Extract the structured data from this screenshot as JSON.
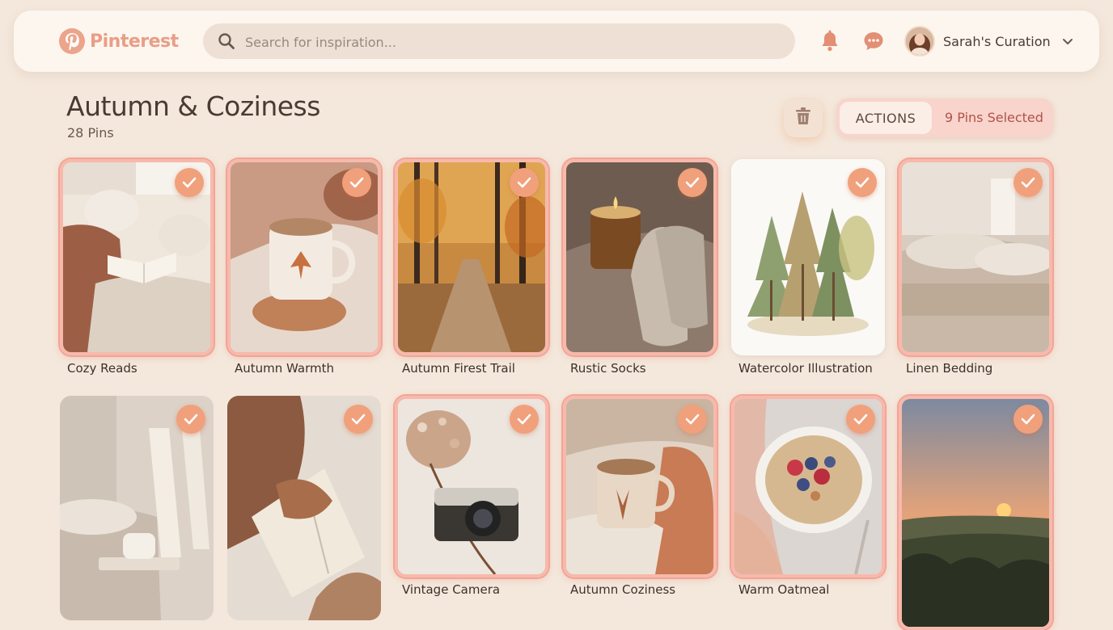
{
  "brand": {
    "name": "Pinterest",
    "color": "#e99e86"
  },
  "search": {
    "placeholder": "Search for inspiration..."
  },
  "header_icons": [
    "search-icon",
    "bell-icon",
    "chat-icon",
    "chevron-down-icon"
  ],
  "user": {
    "name": "Sarah's Curation"
  },
  "board": {
    "title": "Autumn & Coziness",
    "pin_count": "28 Pins"
  },
  "toolbar": {
    "actions_label": "ACTIONS",
    "selected_label": "9 Pins Selected",
    "delete_icon": "trash-icon"
  },
  "colors": {
    "background": "#f4e8dc",
    "accent": "#f1a07c",
    "selection_border": "#f1a596",
    "selected_text": "#b2524a"
  },
  "pins": [
    {
      "caption": "Cozy Reads",
      "selected": true
    },
    {
      "caption": "Autumn Warmth",
      "selected": true
    },
    {
      "caption": "Autumn Firest Trail",
      "selected": true
    },
    {
      "caption": "Rustic Socks",
      "selected": true
    },
    {
      "caption": "Watercolor Illustration",
      "selected": false
    },
    {
      "caption": "Linen Bedding",
      "selected": true
    },
    {
      "caption": "",
      "selected": false
    },
    {
      "caption": "",
      "selected": false
    },
    {
      "caption": "Vintage Camera",
      "selected": true
    },
    {
      "caption": "Autumn Coziness",
      "selected": true
    },
    {
      "caption": "Warm Oatmeal",
      "selected": true
    },
    {
      "caption": "",
      "selected": true
    }
  ]
}
